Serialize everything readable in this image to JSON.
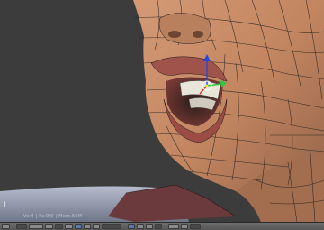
{
  "viewport": {
    "axis_label": "L",
    "stats_text": "Ve:4 | Fa:0/0 | Mem:56M"
  },
  "header": {
    "buttons": [
      {
        "name": "editor-type-button",
        "icon": "grid-icon"
      },
      {
        "name": "view-menu-button",
        "icon": "eye-icon"
      },
      {
        "name": "mode-select",
        "icon": "mode-icon"
      },
      {
        "name": "shading-button",
        "icon": "sphere-icon"
      },
      {
        "name": "pivot-button",
        "icon": "pivot-icon"
      },
      {
        "name": "manipulator-toggle",
        "icon": "manipulator-icon"
      },
      {
        "name": "translate-button",
        "icon": "arrow-icon"
      },
      {
        "name": "rotate-button",
        "icon": "rotate-icon"
      },
      {
        "name": "scale-button",
        "icon": "scale-icon"
      },
      {
        "name": "orientation-select",
        "icon": "orientation-icon"
      },
      {
        "name": "vertex-select-button",
        "icon": "vertex-icon"
      },
      {
        "name": "edge-select-button",
        "icon": "edge-icon"
      },
      {
        "name": "face-select-button",
        "icon": "face-icon"
      },
      {
        "name": "occlude-button",
        "icon": "occlude-icon"
      },
      {
        "name": "proportional-button",
        "icon": "proportional-icon"
      },
      {
        "name": "snap-button",
        "icon": "magnet-icon"
      },
      {
        "name": "render-button",
        "icon": "camera-icon"
      }
    ]
  },
  "colors": {
    "background": "#3c3c3c",
    "skin": "#c48a66",
    "lip": "#a0534b",
    "teeth": "#e8e6d8",
    "wire": "#1a1a1a",
    "floor": "#9aa0b4",
    "axis_x": "#e0282c",
    "axis_y": "#2cc840",
    "axis_z": "#2846e0"
  }
}
